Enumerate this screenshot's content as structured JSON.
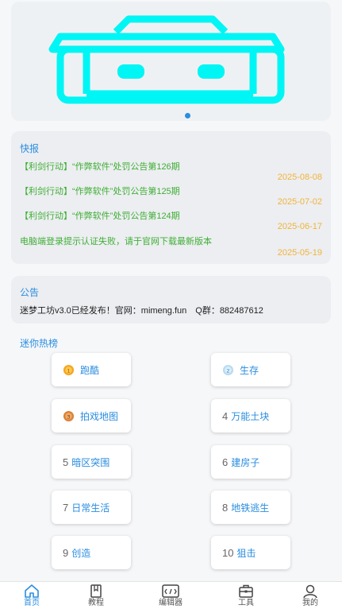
{
  "banner": {
    "slide_count_active": 1
  },
  "news": {
    "title": "快报",
    "items": [
      {
        "title": "【利剑行动】“作弊软件”处罚公告第126期",
        "date": "2025-08-08"
      },
      {
        "title": "【利剑行动】“作弊软件”处罚公告第125期",
        "date": "2025-07-02"
      },
      {
        "title": "【利剑行动】“作弊软件”处罚公告第124期",
        "date": "2025-06-17"
      },
      {
        "title": "电脑端登录提示认证失败，请于官网下载最新版本",
        "date": "2025-05-19"
      }
    ]
  },
  "notice": {
    "title": "公告",
    "text": "迷梦工坊v3.0已经发布！官网：mimeng.fun　Q群：882487612"
  },
  "ranking": {
    "title": "迷你热榜",
    "items": [
      {
        "rank": "1",
        "label": "跑酷",
        "medal": "gold"
      },
      {
        "rank": "2",
        "label": "生存",
        "medal": "silver"
      },
      {
        "rank": "3",
        "label": "拍戏地图",
        "medal": "bronze"
      },
      {
        "rank": "4",
        "label": "万能土块"
      },
      {
        "rank": "5",
        "label": "暗区突围"
      },
      {
        "rank": "6",
        "label": "建房子"
      },
      {
        "rank": "7",
        "label": "日常生活"
      },
      {
        "rank": "8",
        "label": "地铁逃生"
      },
      {
        "rank": "9",
        "label": "创造"
      },
      {
        "rank": "10",
        "label": "狙击"
      }
    ]
  },
  "tabs": [
    {
      "label": "首页",
      "icon": "home-icon",
      "active": true
    },
    {
      "label": "教程",
      "icon": "book-icon"
    },
    {
      "label": "编辑器",
      "icon": "editor-icon"
    },
    {
      "label": "工具",
      "icon": "toolbox-icon"
    },
    {
      "label": "我的",
      "icon": "user-icon"
    }
  ],
  "colors": {
    "accent": "#2a8de0",
    "news_green": "#3fae35",
    "date_orange": "#f2b33a",
    "banner_cyan": "#00f5f5"
  }
}
